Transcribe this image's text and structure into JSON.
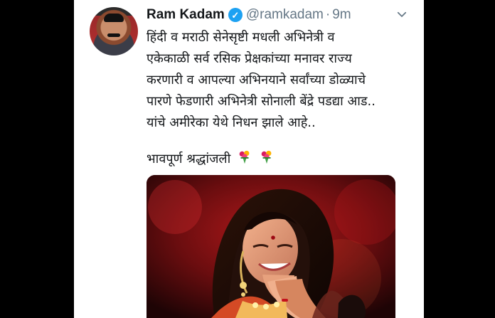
{
  "tweet": {
    "author_name": "Ram Kadam",
    "handle": "@ramkadam",
    "separator": "·",
    "time": "9m",
    "lines": [
      "हिंदी व मराठी सेनेसृष्टी मधली अभिनेत्री व",
      "एकेकाळी सर्व रसिक प्रेक्षकांच्या मनावर राज्य",
      "करणारी व आपल्या अभिनयाने सर्वांच्या डोळ्याचे",
      "पारणे फेडणारी अभिनेत्री सोनाली बेंद्रे पडद्या आड..",
      "यांचे अमीरेका येथे निधन झाले आहे..",
      "भावपूर्ण श्रद्धांजली"
    ],
    "emoji_icons": [
      "bouquet-icon",
      "bouquet-icon"
    ],
    "media_alt": "photo"
  },
  "colors": {
    "verified": "#1da1f2",
    "meta": "#657786",
    "text": "#14171a",
    "background": "#ffffff",
    "outer": "#000000"
  },
  "icons": {
    "verified": "verified-badge-icon",
    "chevron": "chevron-down-icon"
  }
}
